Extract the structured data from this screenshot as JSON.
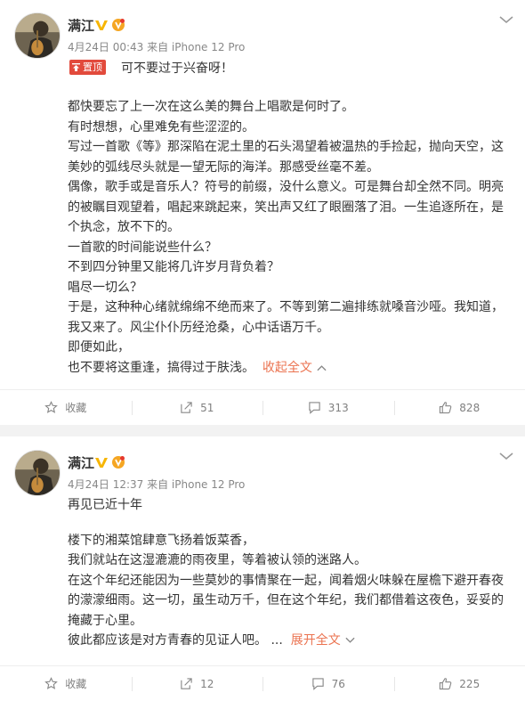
{
  "posts": [
    {
      "username": "满江",
      "meta": "4月24日 00:43 来自 iPhone 12 Pro",
      "pinned_label": "置顶",
      "first_line": "可不要过于兴奋呀！",
      "paragraphs": [
        "都快要忘了上一次在这么美的舞台上唱歌是何时了。",
        "有时想想，心里难免有些涩涩的。",
        "写过一首歌《等》那深陷在泥土里的石头渴望着被温热的手捡起，抛向天空，这美妙的弧线尽头就是一望无际的海洋。那感受丝毫不差。",
        "偶像，歌手或是音乐人？符号的前缀，没什么意义。可是舞台却全然不同。明亮的被瞩目观望着，唱起来跳起来，笑出声又红了眼圈落了泪。一生追逐所在，是个执念，放不下的。",
        "一首歌的时间能说些什么？",
        "不到四分钟里又能将几许岁月背负着？",
        "唱尽一切么？",
        "于是，这种种心绪就绵绵不绝而来了。不等到第二遍排练就嗓音沙哑。我知道，我又来了。风尘仆仆历经沧桑，心中话语万千。",
        "即便如此，"
      ],
      "last_line": "也不要将这重逢，搞得过于肤浅。",
      "toggle_label": "收起全文",
      "toggle_chevron": "^",
      "actions": {
        "favorite": "收藏",
        "repost": "51",
        "comment": "313",
        "like": "828"
      }
    },
    {
      "username": "满江",
      "meta": "4月24日 12:37 来自 iPhone 12 Pro",
      "first_line": "再见已近十年",
      "paragraphs": [
        "楼下的湘菜馆肆意飞扬着饭菜香，",
        "我们就站在这湿漉漉的雨夜里，等着被认领的迷路人。",
        "在这个年纪还能因为一些莫妙的事情聚在一起，闻着烟火味躲在屋檐下避开春夜的濛濛细雨。这一切，虽生动万千，但在这个年纪，我们都借着这夜色，妥妥的掩藏于心里。"
      ],
      "last_line": "彼此都应该是对方青春的见证人吧。",
      "ellipsis": "...",
      "toggle_label": "展开全文",
      "toggle_chevron": "v",
      "actions": {
        "favorite": "收藏",
        "repost": "12",
        "comment": "76",
        "like": "225"
      }
    }
  ],
  "colors": {
    "link": "#eb7350",
    "pin_badge": "#e24a3c",
    "verified": "#f7b500",
    "meta": "#888888"
  },
  "icons": [
    "avatar-photo",
    "verified-v-icon",
    "level-badge-icon",
    "more-chevron-icon",
    "pin-icon",
    "star-icon",
    "repost-icon",
    "comment-icon",
    "like-icon"
  ]
}
